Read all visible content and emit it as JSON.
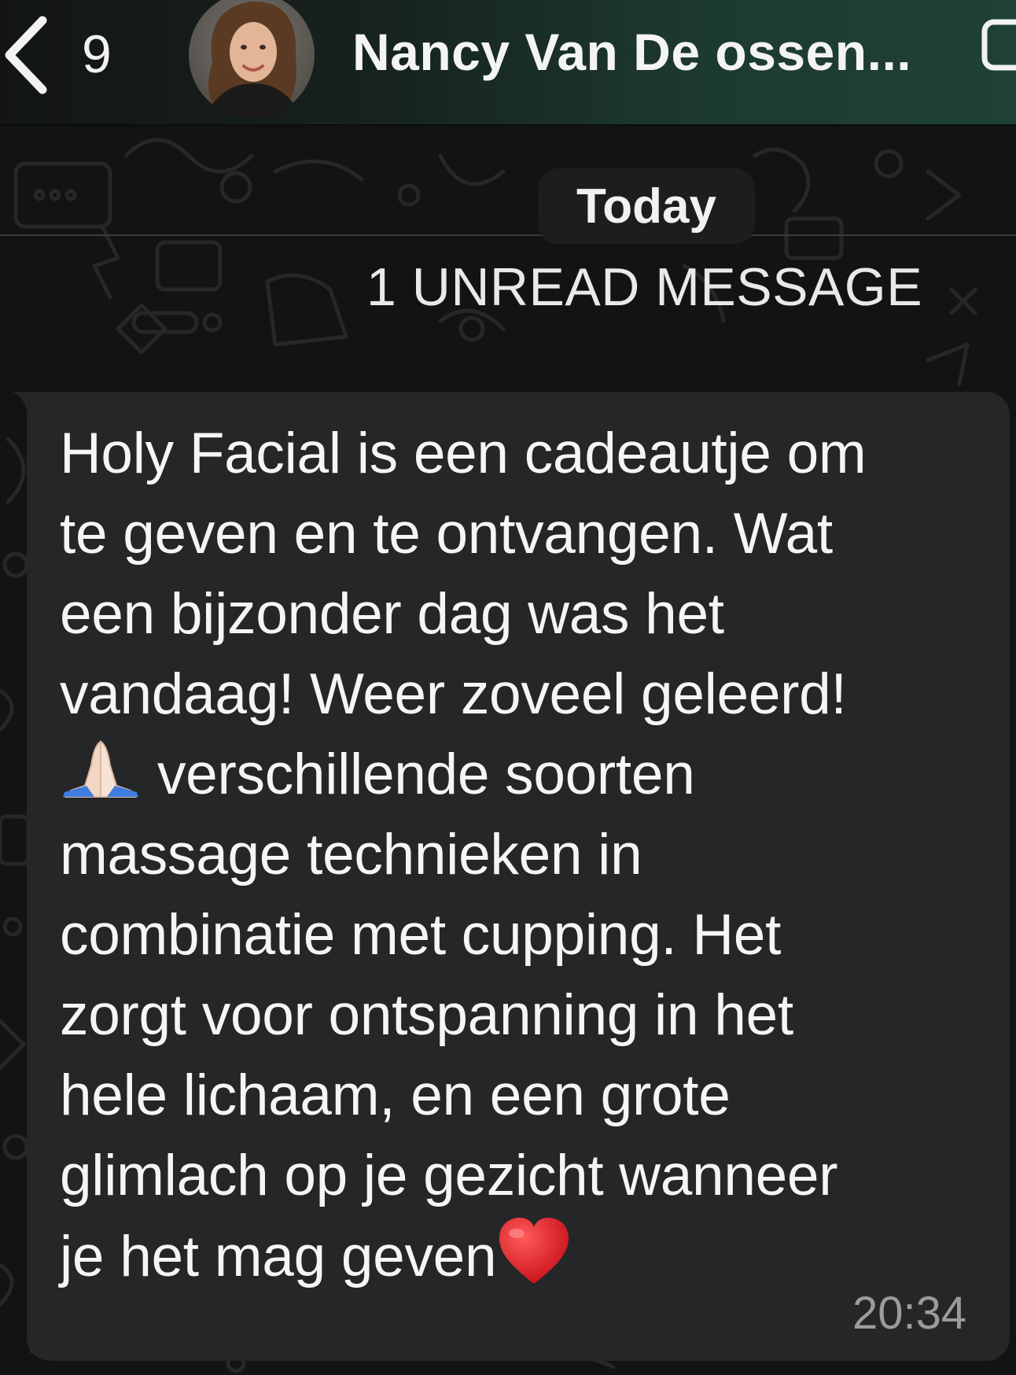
{
  "header": {
    "back_count": "9",
    "contact_name": "Nancy Van De ossen..."
  },
  "chat": {
    "date_label": "Today",
    "unread_label": "1 UNREAD MESSAGE"
  },
  "message": {
    "lines": [
      "Holy Facial is een cadeautje om",
      "te geven en te ontvangen. Wat",
      "een bijzonder dag was het",
      "vandaag! Weer zoveel geleerd!",
      " verschillende soorten",
      "massage technieken in",
      "combinatie met cupping. Het",
      "zorgt voor ontspanning in het",
      "hele lichaam, en een grote",
      "glimlach op je gezicht wanneer",
      "je het mag geven"
    ],
    "time": "20:34",
    "emojis": [
      "folded-hands",
      "red-heart"
    ]
  },
  "colors": {
    "header_accent": "#1f4234",
    "bubble": "#252628",
    "background": "#121313"
  }
}
